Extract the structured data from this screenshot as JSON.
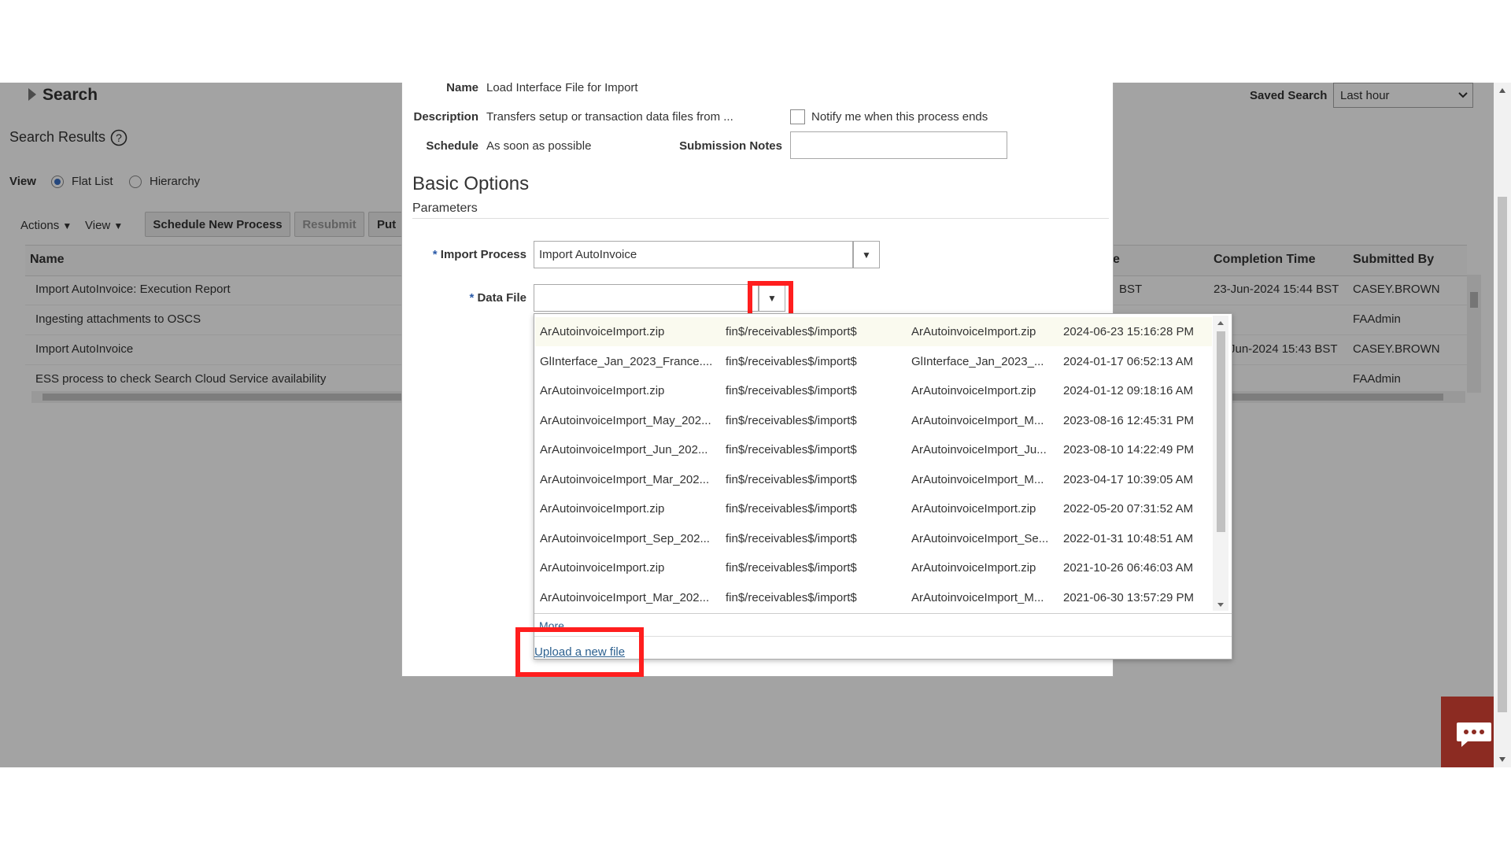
{
  "background": {
    "search_header": "Search",
    "saved_search_label": "Saved Search",
    "saved_search_value": "Last hour",
    "search_results_title": "Search Results",
    "view_label": "View",
    "view_options": [
      "Flat List",
      "Hierarchy"
    ],
    "toolbar": {
      "actions": "Actions",
      "view": "View",
      "schedule_new_process": "Schedule New Process",
      "resubmit": "Resubmit",
      "put_truncated": "Put"
    },
    "columns": {
      "name": "Name",
      "status_truncated": "e",
      "completion_time": "Completion Time",
      "submitted_by": "Submitted By"
    },
    "rows": [
      {
        "name": "Import AutoInvoice: Execution Report",
        "status": "BST",
        "completion": "23-Jun-2024 15:44 BST",
        "by": "CASEY.BROWN"
      },
      {
        "name": "Ingesting attachments to OSCS",
        "status": "",
        "completion": "",
        "by": "FAAdmin"
      },
      {
        "name": "Import AutoInvoice",
        "status": "Jun-2024 15:43 BST",
        "completion": "",
        "by": "CASEY.BROWN"
      },
      {
        "name": "ESS process to check Search Cloud Service availability",
        "status": "",
        "completion": "",
        "by": "FAAdmin"
      }
    ]
  },
  "dialog": {
    "name_label": "Name",
    "name_value": "Load Interface File for Import",
    "description_label": "Description",
    "description_value": "Transfers setup or transaction data files from ...",
    "notify_label": "Notify me when this process ends",
    "schedule_label": "Schedule",
    "schedule_value": "As soon as possible",
    "submission_notes_label": "Submission Notes",
    "section_title": "Basic Options",
    "section_subtitle": "Parameters",
    "required_marker": "*",
    "import_process_label": "Import Process",
    "import_process_value": "Import AutoInvoice",
    "data_file_label": "Data File",
    "data_file_value": ""
  },
  "data_file_popup": {
    "rows": [
      [
        "ArAutoinvoiceImport.zip",
        "fin$/receivables$/import$",
        "ArAutoinvoiceImport.zip",
        "2024-06-23 15:16:28 PM"
      ],
      [
        "GlInterface_Jan_2023_France....",
        "fin$/receivables$/import$",
        "GlInterface_Jan_2023_...",
        "2024-01-17 06:52:13 AM"
      ],
      [
        "ArAutoinvoiceImport.zip",
        "fin$/receivables$/import$",
        "ArAutoinvoiceImport.zip",
        "2024-01-12 09:18:16 AM"
      ],
      [
        "ArAutoinvoiceImport_May_202...",
        "fin$/receivables$/import$",
        "ArAutoinvoiceImport_M...",
        "2023-08-16 12:45:31 PM"
      ],
      [
        "ArAutoinvoiceImport_Jun_202...",
        "fin$/receivables$/import$",
        "ArAutoinvoiceImport_Ju...",
        "2023-08-10 14:22:49 PM"
      ],
      [
        "ArAutoinvoiceImport_Mar_202...",
        "fin$/receivables$/import$",
        "ArAutoinvoiceImport_M...",
        "2023-04-17 10:39:05 AM"
      ],
      [
        "ArAutoinvoiceImport.zip",
        "fin$/receivables$/import$",
        "ArAutoinvoiceImport.zip",
        "2022-05-20 07:31:52 AM"
      ],
      [
        "ArAutoinvoiceImport_Sep_202...",
        "fin$/receivables$/import$",
        "ArAutoinvoiceImport_Se...",
        "2022-01-31 10:48:51 AM"
      ],
      [
        "ArAutoinvoiceImport.zip",
        "fin$/receivables$/import$",
        "ArAutoinvoiceImport.zip",
        "2021-10-26 06:46:03 AM"
      ],
      [
        "ArAutoinvoiceImport_Mar_202...",
        "fin$/receivables$/import$",
        "ArAutoinvoiceImport_M...",
        "2021-06-30 13:57:29 PM"
      ]
    ],
    "more_link": "More...",
    "upload_link": "Upload a new file"
  },
  "colors": {
    "highlight": "#ff1e1e",
    "footer": "#27474d",
    "chat": "#8c2b22",
    "link": "#2b5f8e"
  }
}
